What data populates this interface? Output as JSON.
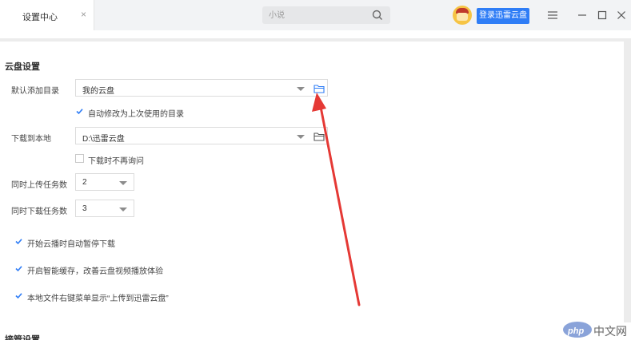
{
  "titlebar": {
    "tab_label": "设置中心",
    "tab_close": "×",
    "search_placeholder": "小说",
    "login_label": "登录迅雷云盘"
  },
  "cloud_settings": {
    "title": "云盘设置",
    "default_dir_label": "默认添加目录",
    "default_dir_value": "我的云盘",
    "auto_modify_label": "自动修改为上次使用的目录",
    "auto_modify_checked": true,
    "download_local_label": "下载到本地",
    "download_local_value": "D:\\迅雷云盘",
    "no_ask_label": "下载时不再询问",
    "no_ask_checked": false,
    "upload_tasks_label": "同时上传任务数",
    "upload_tasks_value": "2",
    "download_tasks_label": "同时下载任务数",
    "download_tasks_value": "3",
    "options": [
      {
        "label": "开始云播时自动暂停下载",
        "checked": true
      },
      {
        "label": "开启智能缓存，改善云盘视频播放体验",
        "checked": true
      },
      {
        "label": "本地文件右键菜单显示“上传到迅雷云盘”",
        "checked": true
      }
    ]
  },
  "next_section_title": "接管设置",
  "watermark": {
    "logo": "php",
    "site": "中文网"
  },
  "colors": {
    "accent": "#2f7df6",
    "arrow": "#e53935",
    "check": "#2f7df6"
  }
}
